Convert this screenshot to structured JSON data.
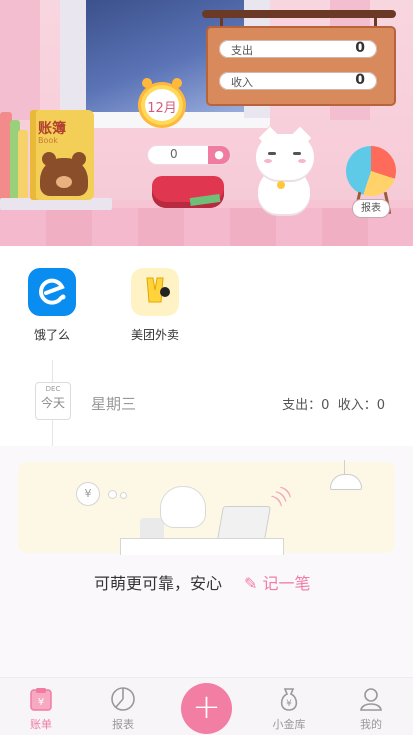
{
  "hero": {
    "ledger_book": {
      "title": "账簿",
      "subtitle": "Book"
    },
    "calendar_month": "12月",
    "summary": [
      {
        "label": "支出",
        "value": "0"
      },
      {
        "label": "收入",
        "value": "0"
      }
    ],
    "balance_value": "0",
    "report_label": "报表",
    "colors": {
      "accent": "#f07ca2",
      "board": "#d98a5c"
    }
  },
  "quick_apps": [
    {
      "label": "饿了么",
      "icon": "eleme-icon",
      "color": "#0a8df0"
    },
    {
      "label": "美团外卖",
      "icon": "meituan-waimai-icon",
      "color": "#ffd33b"
    }
  ],
  "timeline": {
    "month_abbr": "DEC",
    "day_label": "今天",
    "weekday": "星期三",
    "expense_label": "支出：",
    "expense_value": "0",
    "income_label": "收入：",
    "income_value": "0"
  },
  "empty_state": {
    "slogan": "可萌更可靠，安心",
    "action": "记一笔"
  },
  "tabbar": {
    "items": [
      {
        "label": "账单",
        "icon": "ledger-icon",
        "active": true
      },
      {
        "label": "报表",
        "icon": "pie-chart-icon",
        "active": false
      },
      {
        "label": "",
        "icon": "plus-icon",
        "active": false
      },
      {
        "label": "小金库",
        "icon": "money-bag-icon",
        "active": false
      },
      {
        "label": "我的",
        "icon": "user-icon",
        "active": false
      }
    ]
  }
}
